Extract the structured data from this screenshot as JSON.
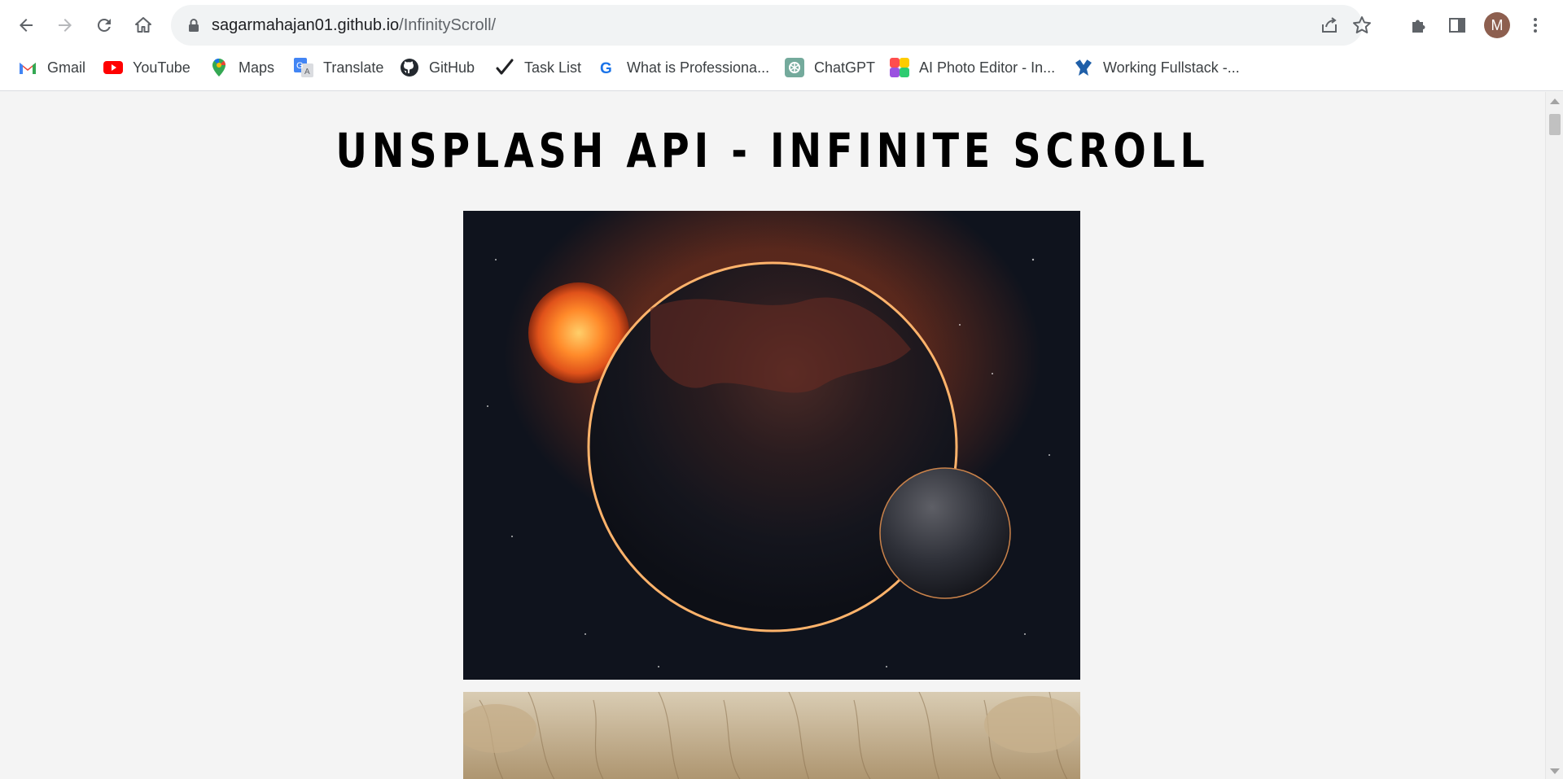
{
  "browser": {
    "url_host": "sagarmahajan01.github.io",
    "url_path": "/InfinityScroll/",
    "profile_initial": "M",
    "bookmarks": [
      {
        "label": "Gmail",
        "icon": "gmail-icon"
      },
      {
        "label": "YouTube",
        "icon": "youtube-icon"
      },
      {
        "label": "Maps",
        "icon": "maps-icon"
      },
      {
        "label": "Translate",
        "icon": "translate-icon"
      },
      {
        "label": "GitHub",
        "icon": "github-icon"
      },
      {
        "label": "Task List",
        "icon": "checkmark-icon"
      },
      {
        "label": "What is Professiona...",
        "icon": "g-icon"
      },
      {
        "label": "ChatGPT",
        "icon": "chatgpt-icon"
      },
      {
        "label": "AI Photo Editor - In...",
        "icon": "photo-editor-icon"
      },
      {
        "label": "Working Fullstack -...",
        "icon": "fullstack-icon"
      }
    ]
  },
  "page": {
    "title": "UNSPLASH API - INFINITE SCROLL",
    "images": [
      {
        "subject": "planets and sun in space"
      },
      {
        "subject": "close-up of animal fur"
      }
    ]
  },
  "colors": {
    "accent_avatar": "#8d5f4f",
    "page_background": "#f4f4f4"
  }
}
